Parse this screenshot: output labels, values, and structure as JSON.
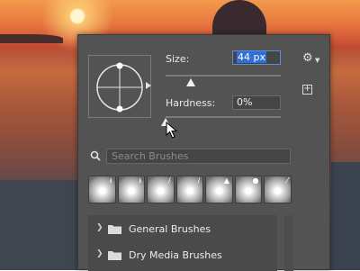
{
  "brush_panel": {
    "size_label": "Size:",
    "size_value": "44 px",
    "hardness_label": "Hardness:",
    "hardness_value": "0%",
    "size_slider_fraction": 0.22,
    "hardness_slider_fraction": 0.0,
    "search_placeholder": "Search Brushes",
    "presets": [
      {
        "icon": "airbrush-icon",
        "glyph": "⭳"
      },
      {
        "icon": "airbrush-icon",
        "glyph": "⭳"
      },
      {
        "icon": "brush-icon",
        "glyph": "/"
      },
      {
        "icon": "brush-icon",
        "glyph": "/"
      },
      {
        "icon": "triangle-icon",
        "glyph": "▲"
      },
      {
        "icon": "pin-icon",
        "glyph": "●"
      },
      {
        "icon": "pencil-icon",
        "glyph": "⁄"
      },
      {
        "icon": "pencil-icon",
        "glyph": "⁄"
      }
    ],
    "groups": [
      {
        "label": "General Brushes"
      },
      {
        "label": "Dry Media Brushes"
      }
    ]
  },
  "colors": {
    "panel_bg": "#535353",
    "field_bg": "#454545",
    "selection": "#2f6fd6"
  }
}
